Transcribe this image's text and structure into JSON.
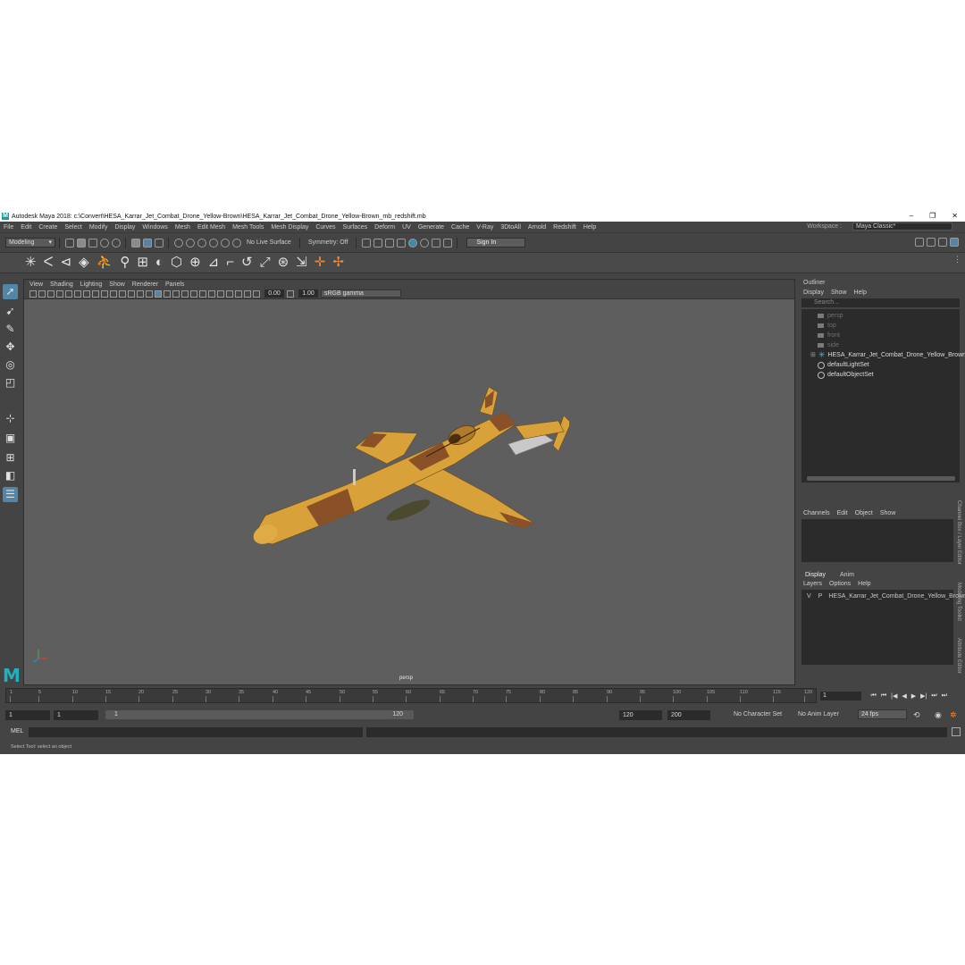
{
  "window": {
    "title": "Autodesk Maya 2018: c:\\Convert\\HESA_Karrar_Jet_Combat_Drone_Yellow-Brown\\HESA_Karrar_Jet_Combat_Drone_Yellow-Brown_mb_redshift.mb",
    "logo_letter": "M",
    "minimize": "–",
    "maximize": "❐",
    "close": "✕"
  },
  "menubar": {
    "items": [
      "File",
      "Edit",
      "Create",
      "Select",
      "Modify",
      "Display",
      "Windows",
      "Mesh",
      "Edit Mesh",
      "Mesh Tools",
      "Mesh Display",
      "Curves",
      "Surfaces",
      "Deform",
      "UV",
      "Generate",
      "Cache",
      "V-Ray",
      "3DtoAll",
      "Arnold",
      "Redshift",
      "Help"
    ],
    "workspace_label": "Workspace :",
    "workspace_value": "Maya Classic*"
  },
  "statusline": {
    "mode": "Modeling",
    "live_surface": "No Live Surface",
    "symmetry": "Symmetry: Off",
    "sign_in": "Sign In"
  },
  "viewport": {
    "menu": [
      "View",
      "Shading",
      "Lighting",
      "Show",
      "Renderer",
      "Panels"
    ],
    "exposure": "0.00",
    "gamma": "1.00",
    "color_space": "sRGB gamma",
    "camera_label": "persp",
    "model_colors": {
      "yellow": "#d9a13a",
      "brown": "#8a5128",
      "metal": "#c9c9c9",
      "bomb": "#4b4a2e"
    }
  },
  "outliner": {
    "title": "Outliner",
    "menu": [
      "Display",
      "Show",
      "Help"
    ],
    "search_placeholder": "Search...",
    "cameras": [
      "persp",
      "top",
      "front",
      "side"
    ],
    "group": "HESA_Karrar_Jet_Combat_Drone_Yellow_Brown_mb",
    "sets": [
      "defaultLightSet",
      "defaultObjectSet"
    ]
  },
  "channelbox": {
    "menu": [
      "Channels",
      "Edit",
      "Object",
      "Show"
    ]
  },
  "layers": {
    "tabs": [
      "Display",
      "Anim"
    ],
    "menu": [
      "Layers",
      "Options",
      "Help"
    ],
    "row": {
      "v": "V",
      "p": "P",
      "name": "HESA_Karrar_Jet_Combat_Drone_Yellow_Brown",
      "color": "#8a0f22"
    }
  },
  "side_tabs": [
    "Channel Box / Layer Editor",
    "Modeling Toolkit",
    "Attribute Editor"
  ],
  "timeslider": {
    "ticks": [
      "1",
      "5",
      "10",
      "15",
      "20",
      "25",
      "30",
      "35",
      "40",
      "45",
      "50",
      "55",
      "60",
      "65",
      "70",
      "75",
      "80",
      "85",
      "90",
      "95",
      "100",
      "105",
      "110",
      "115",
      "120"
    ],
    "current_frame": "1",
    "playback_icons": [
      "⏮",
      "⏮",
      "|◀",
      "◀",
      "▶",
      "▶|",
      "⏭",
      "⏭"
    ]
  },
  "range": {
    "start": "1",
    "start_inner": "1",
    "range_lo": "1",
    "range_hi": "120",
    "end_inner": "120",
    "end": "200",
    "character_set": "No Character Set",
    "anim_layer": "No Anim Layer",
    "fps": "24 fps"
  },
  "command": {
    "label": "MEL",
    "help": "Select Tool: select an object"
  }
}
